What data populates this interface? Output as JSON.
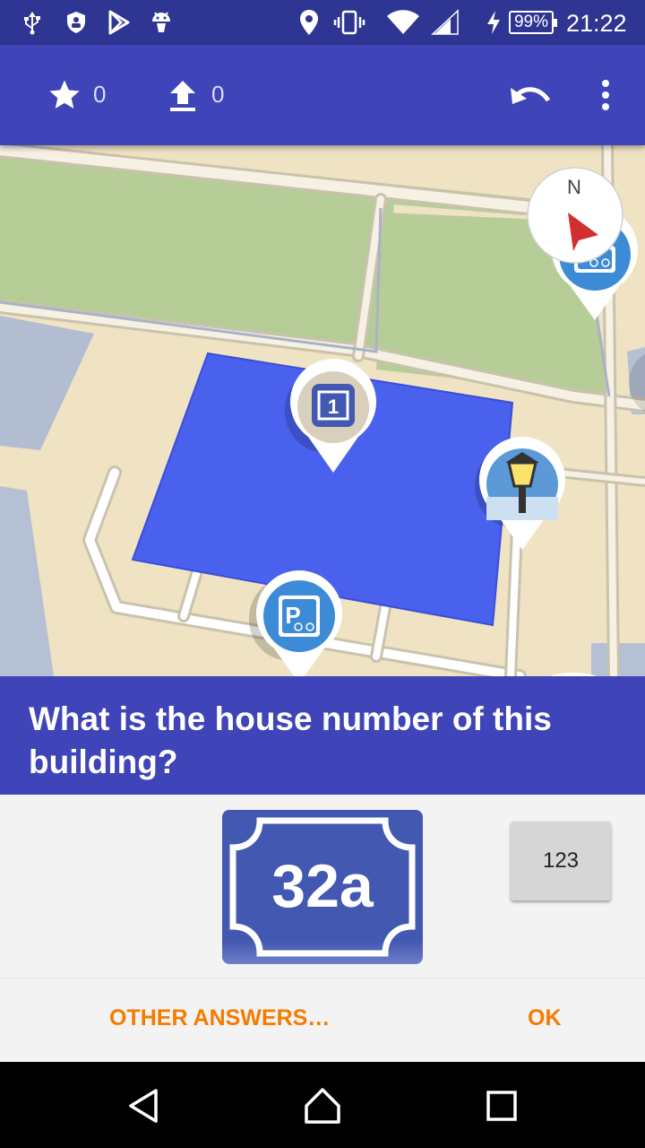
{
  "status_bar": {
    "battery": "99%",
    "time": "21:22",
    "icons": [
      "usb-icon",
      "shield-icon",
      "play-store-icon",
      "android-icon",
      "location-icon",
      "vibrate-icon",
      "wifi-icon",
      "signal-icon",
      "charging-icon"
    ]
  },
  "toolbar": {
    "stars_count": "0",
    "upload_count": "0",
    "icons": [
      "star-icon",
      "upload-icon",
      "undo-icon",
      "more-vert-icon"
    ]
  },
  "map": {
    "compass_label": "N",
    "house_marker_label": "1",
    "pin_icons": [
      "bicycle-parking-icon",
      "housenumber-icon",
      "street-lamp-icon",
      "bicycle-parking-icon"
    ]
  },
  "quest": {
    "question": "What is the house number of this building?",
    "answer_value": "32a",
    "keyboard_toggle_label": "123"
  },
  "buttons": {
    "other_answers": "OTHER ANSWERS…",
    "ok": "OK"
  },
  "navbar": {
    "icons": [
      "back-icon",
      "home-icon",
      "recents-icon"
    ]
  },
  "colors": {
    "primary": "#3f44b8",
    "status_bar": "#2e3593",
    "accent": "#f57c00",
    "building_highlight": "#4a61ee"
  }
}
